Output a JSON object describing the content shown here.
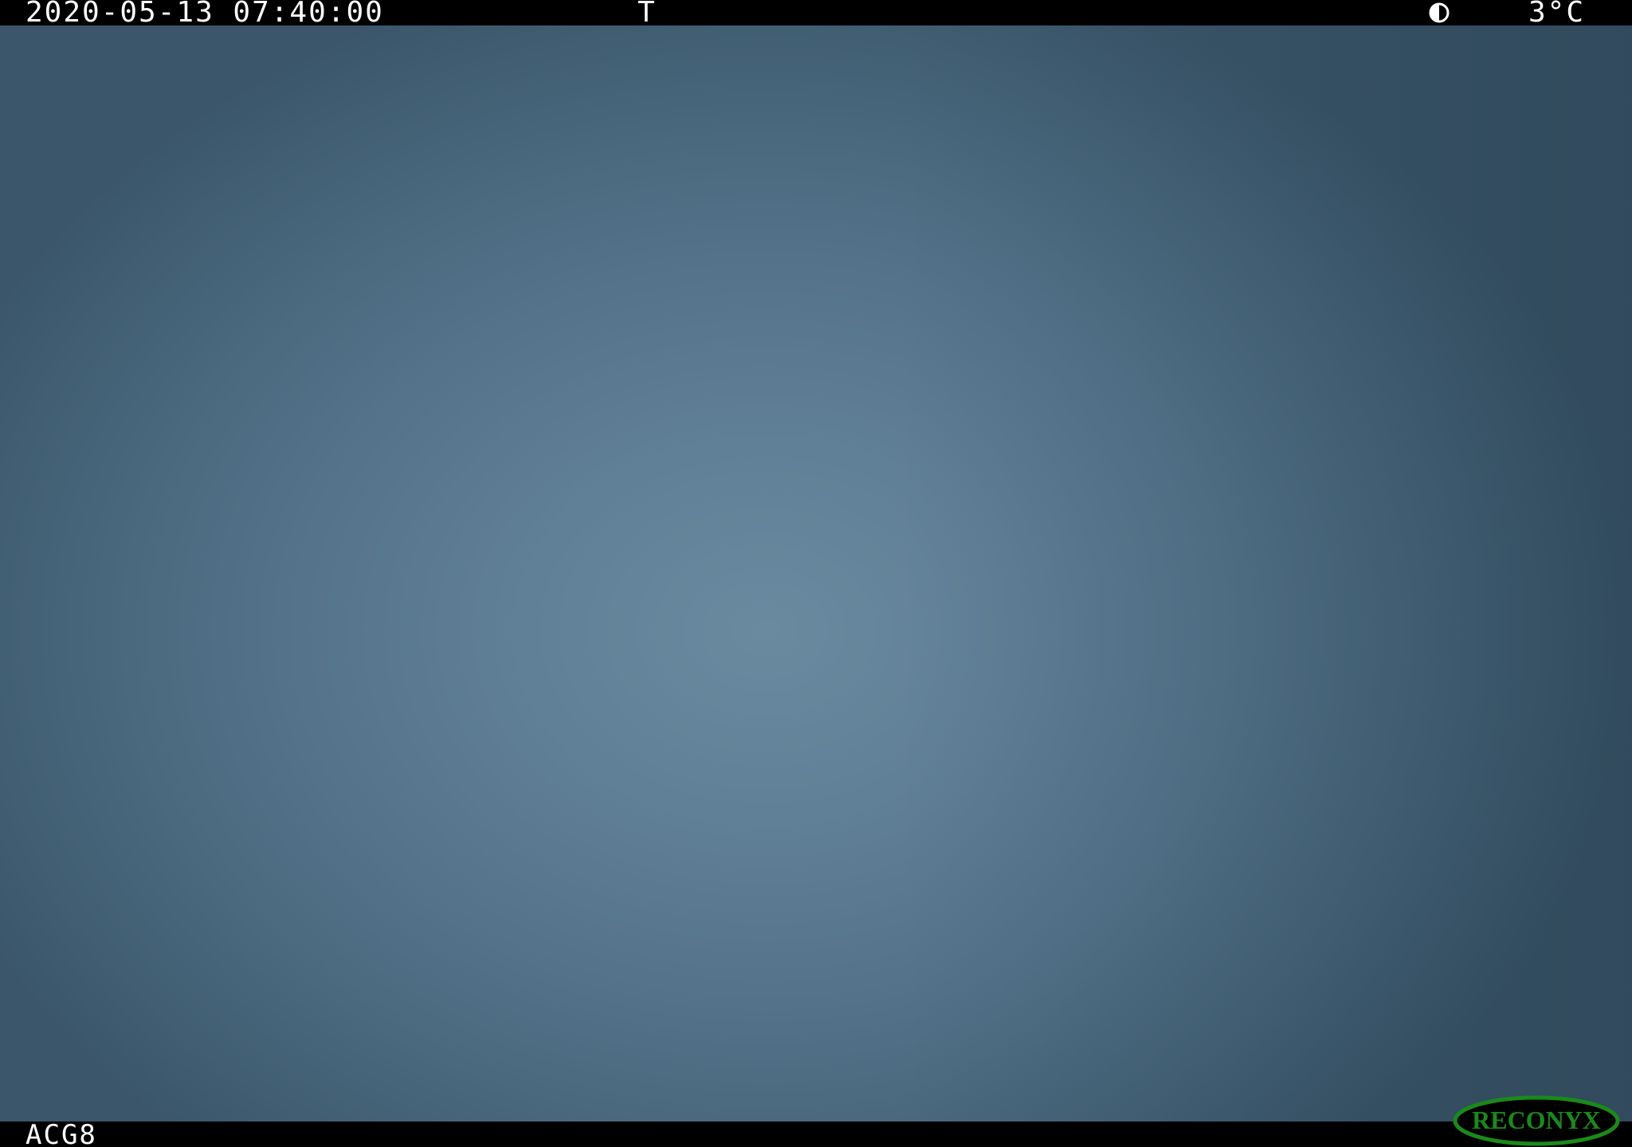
{
  "overlay": {
    "datetime": "2020-05-13  07:40:00",
    "trigger": "T",
    "moon_phase_icon": "half-moon-icon",
    "temperature": "3°C",
    "camera_id": "ACG8"
  },
  "brand": {
    "logo_text": "RECONYX",
    "logo_color": "#1a8a1a"
  },
  "colors": {
    "bar": "#000000",
    "overlay_text": "#ffffff",
    "sky_center": "#6a8aa0",
    "sky_edge": "#3b566a"
  }
}
